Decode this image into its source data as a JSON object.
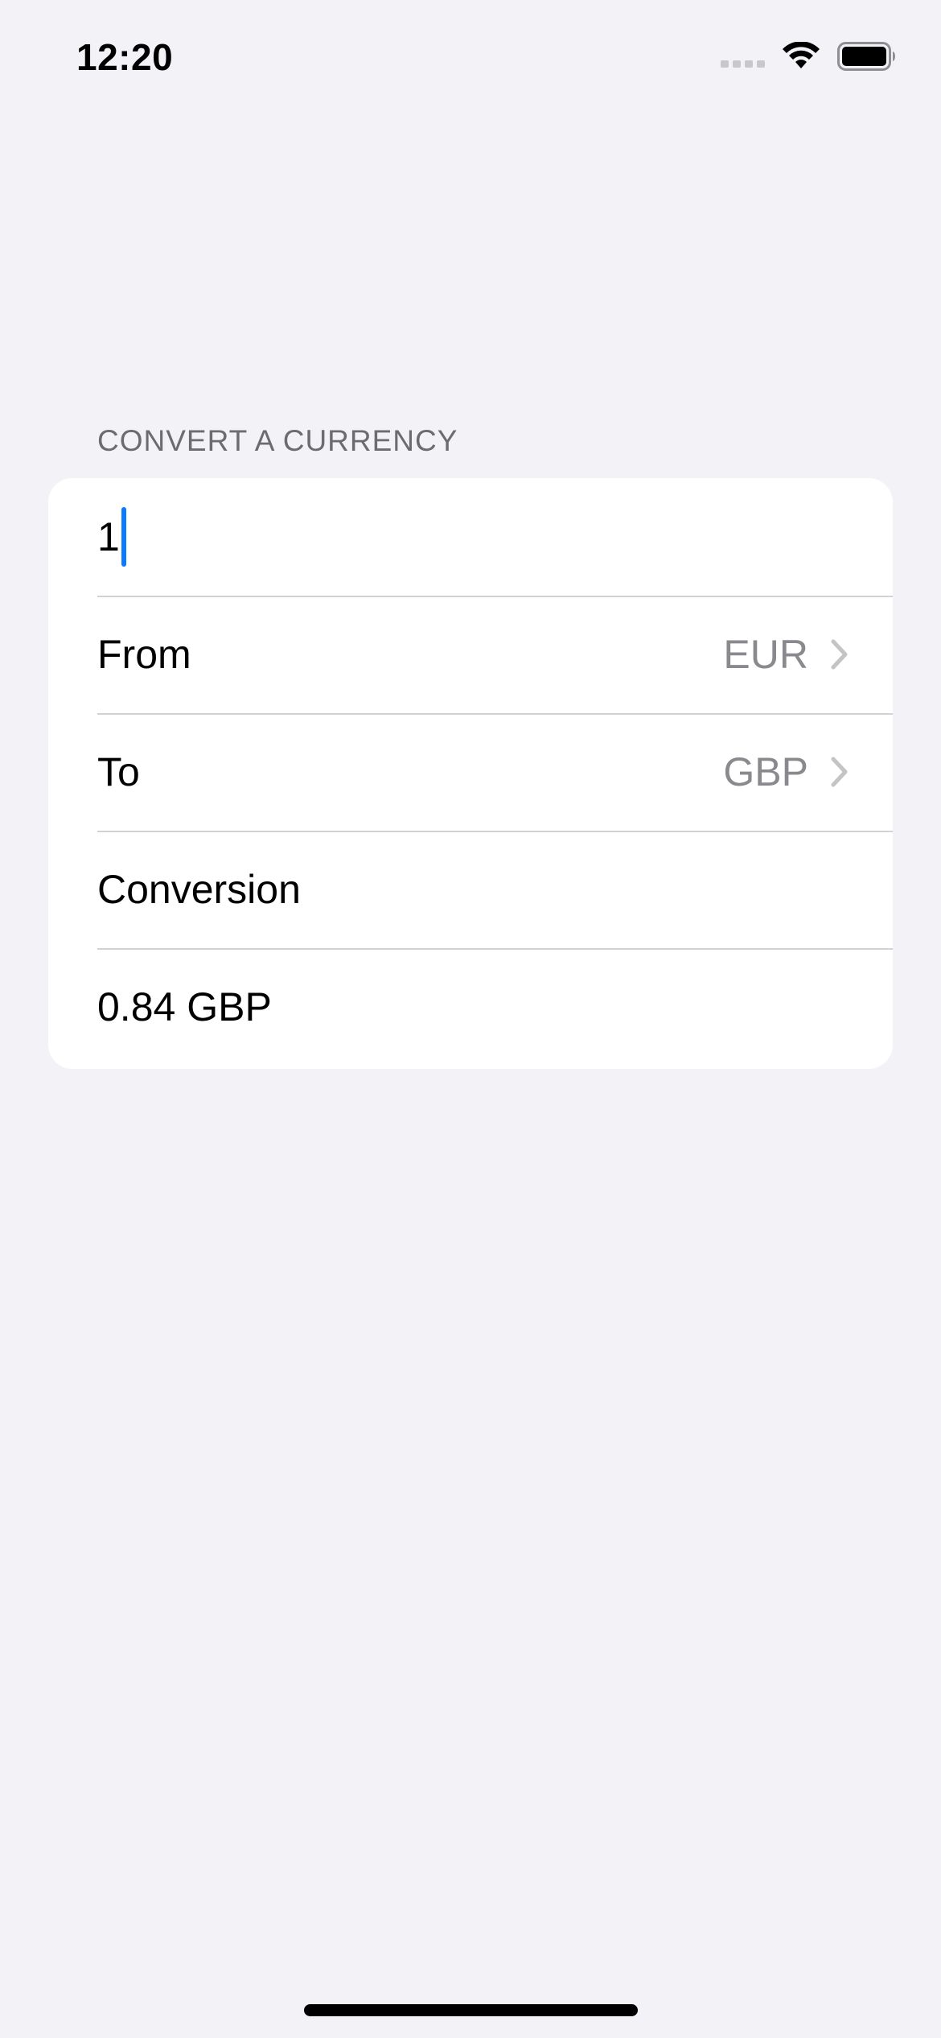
{
  "status_bar": {
    "time": "12:20",
    "icons": [
      "cellular-signal-icon",
      "wifi-icon",
      "battery-icon"
    ]
  },
  "form": {
    "section_header": "CONVERT A CURRENCY",
    "amount_value": "1",
    "from_label": "From",
    "from_value": "EUR",
    "to_label": "To",
    "to_value": "GBP",
    "conversion_label": "Conversion",
    "conversion_result": "0.84 GBP"
  },
  "colors": {
    "background": "#f2f2f7",
    "card": "#ffffff",
    "accent_caret": "#0a7aff",
    "secondary_text": "#8a8a8e",
    "section_header_text": "#6c6c70",
    "separator": "#d1d1d6"
  }
}
